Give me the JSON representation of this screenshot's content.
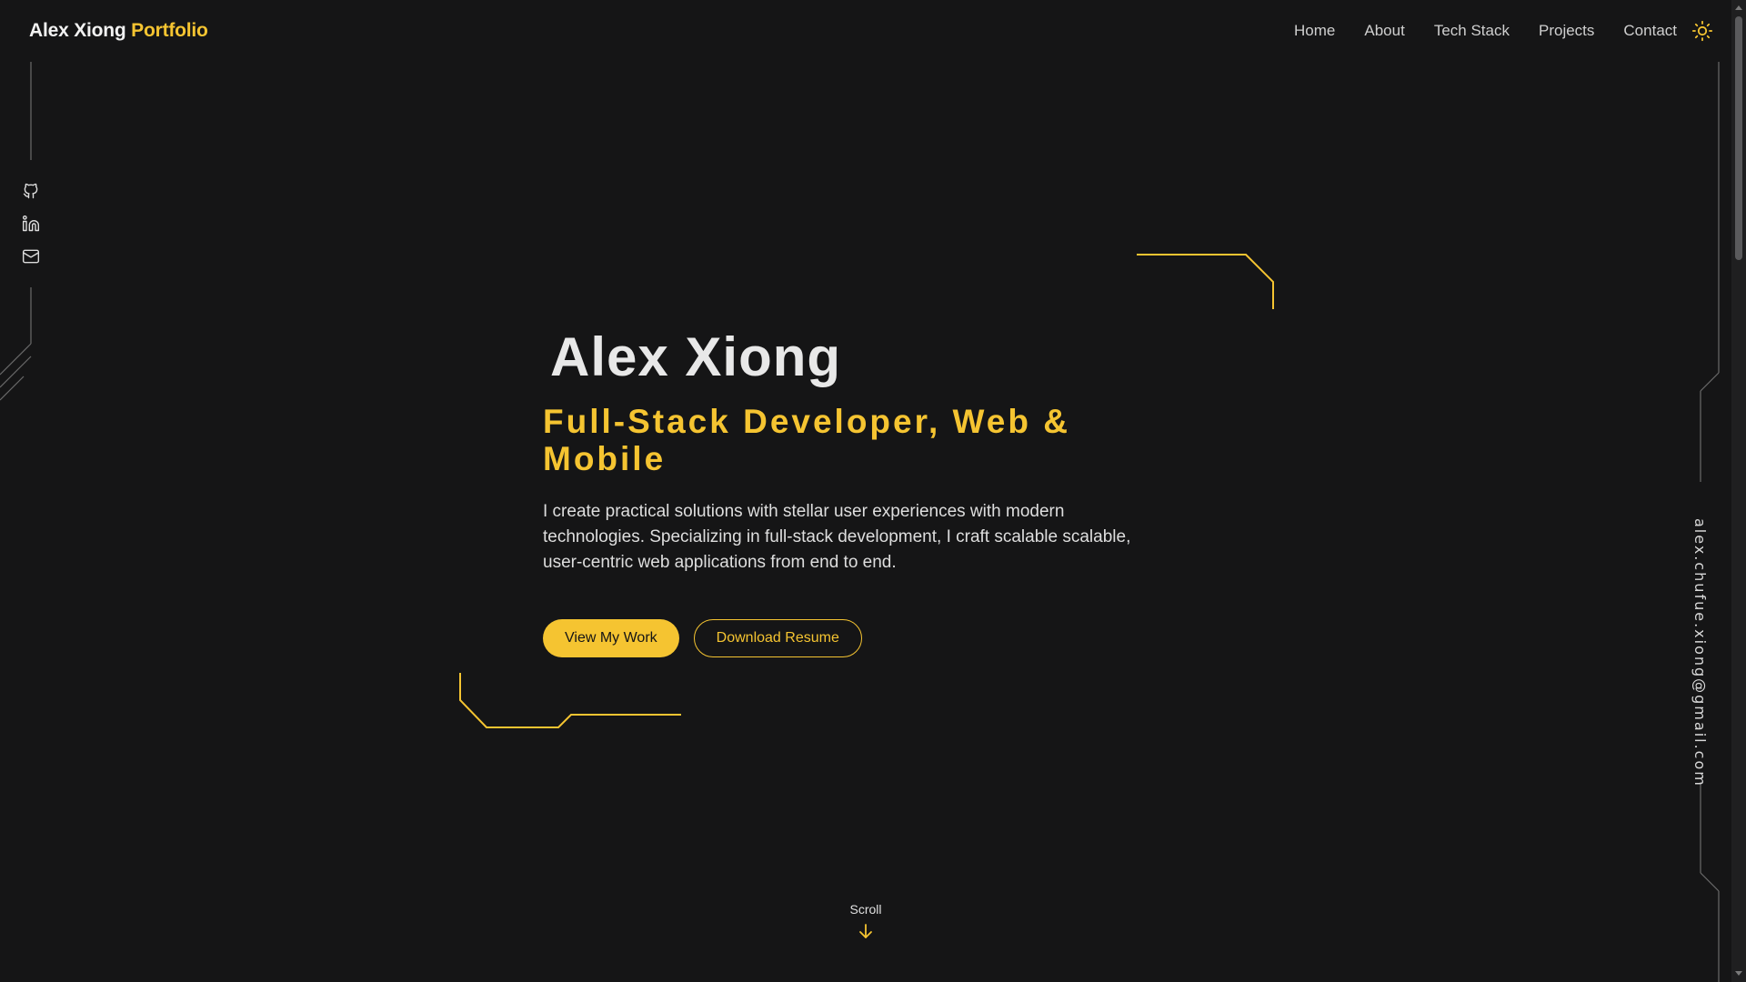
{
  "header": {
    "brand_name": "Alex Xiong",
    "brand_accent": "Portfolio",
    "nav": [
      "Home",
      "About",
      "Tech Stack",
      "Projects",
      "Contact"
    ],
    "theme_toggle_icon": "sun-icon"
  },
  "social": {
    "icons": [
      "github-icon",
      "linkedin-icon",
      "mail-icon"
    ]
  },
  "hero": {
    "name": "Alex Xiong",
    "role": "Full-Stack Developer, Web & Mobile",
    "description": "I create practical solutions with stellar user experiences with modern technologies. Specializing in full-stack development, I craft scalable scalable, user-centric web applications from end to end.",
    "primary_button": "View My Work",
    "secondary_button": "Download Resume"
  },
  "side_email": "alex.chufue.xiong@gmail.com",
  "scroll": {
    "label": "Scroll",
    "icon": "arrow-down-icon"
  },
  "colors": {
    "background": "#151516",
    "accent": "#f5c431",
    "text": "#e8e8e8"
  }
}
